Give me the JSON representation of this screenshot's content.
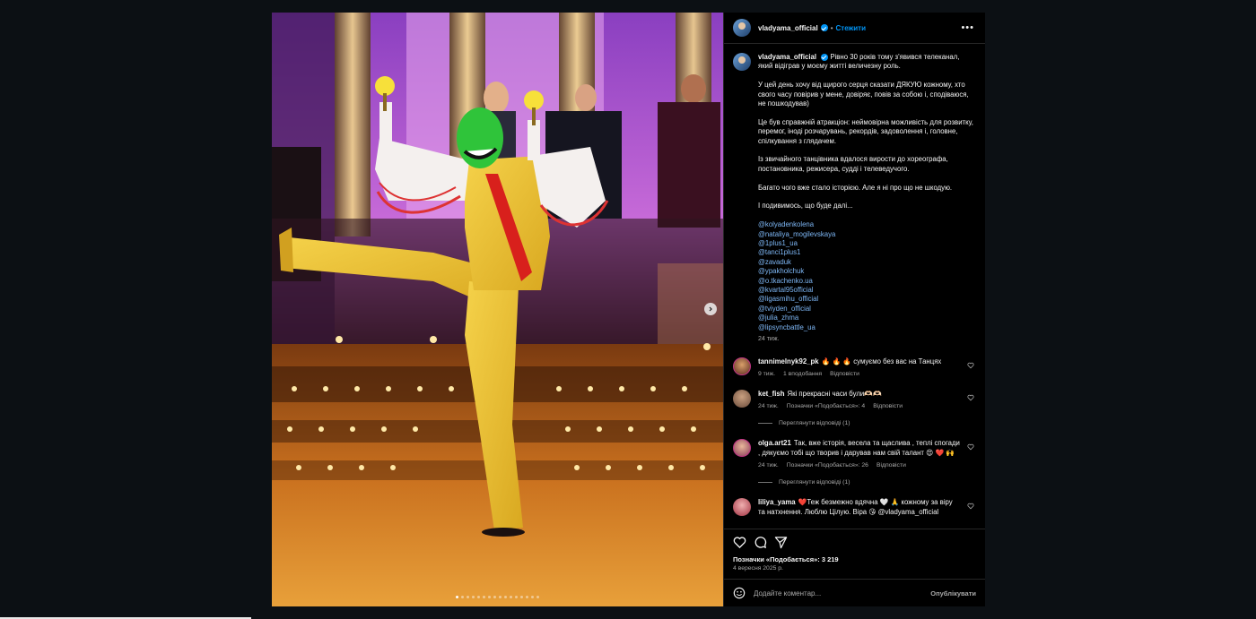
{
  "post": {
    "username": "vladyama_official",
    "separator": "•",
    "follow_label": "Стежити",
    "more_icon": "more-horizontal-icon"
  },
  "caption": {
    "username": "vladyama_official",
    "line1": "Рівно 30 років тому з'явився телеканал, який відіграв у моєму житті величезну роль.",
    "p2": "У цей день хочу від щирого серця сказати ДЯКУЮ кожному, хто свого часу повірив у мене, довіряє, повів за собою і, сподіваюся, не пошкодував)",
    "p3": "Це був справжній атракціон: неймовірна можливість для розвитку, перемог, іноді розчарувань, рекордів, задоволення і, головне, спілкування з глядачем.",
    "p4": "Із звичайного танцівника вдалося вирости до хореографа, постановника, режисера, судді і телеведучого.",
    "p5": "Багато чого вже стало історією. Але я ні про що не шкодую.",
    "p6": "І подивимось, що буде далі...",
    "tags": [
      "@kolyadenkolena",
      "@nataliya_mogilevskaya",
      "@1plus1_ua",
      "@tanci1plus1",
      "@zavaduk",
      "@ypakholchuk",
      "@o.tkachenko.ua",
      "@kvartal95official",
      "@ligasmihu_official",
      "@tviyden_official",
      "@julia_zhma",
      "@lipsyncbattle_ua"
    ],
    "time": "24 тиж."
  },
  "comments": [
    {
      "username": "tannimelnyk92_pk",
      "text": "🔥 🔥 🔥 сумуємо без вас на Танцях",
      "time": "9 тиж.",
      "meta2": "1 вподобання",
      "reply": "Відповісти"
    },
    {
      "username": "ket_fish",
      "text": "Які прекрасні часи були🫶🏻🫶🏻",
      "time": "24 тиж.",
      "meta2": "Позначки «Подобається»: 4",
      "reply": "Відповісти",
      "view_replies": "Переглянути відповіді (1)"
    },
    {
      "username": "olga.art21",
      "text": "Так, вже історія, весела та щаслива , теплі спогади , дякуємо тобі що творив і дарував нам свій талант 😍 ❤️ 🙌",
      "time": "24 тиж.",
      "meta2": "Позначки «Подобається»: 26",
      "reply": "Відповісти",
      "view_replies": "Переглянути відповіді (1)"
    },
    {
      "username": "liliya_yama",
      "text": "❤️Теж безмежно вдячна 🤍 🙏 кожному за віру та натхнення. Люблю Цілую. Віра 😘 @vladyama_official"
    }
  ],
  "footer": {
    "likes": "Позначки «Подобається»: 3 219",
    "date": "4 вересня 2025 р.",
    "comment_placeholder": "Додайте коментар...",
    "publish_label": "Опублікувати"
  },
  "carousel": {
    "slide_count": 16,
    "active_index": 0
  },
  "colors": {
    "accent": "#0095f6",
    "link": "#7db6f4",
    "panel_bg": "#000000"
  }
}
